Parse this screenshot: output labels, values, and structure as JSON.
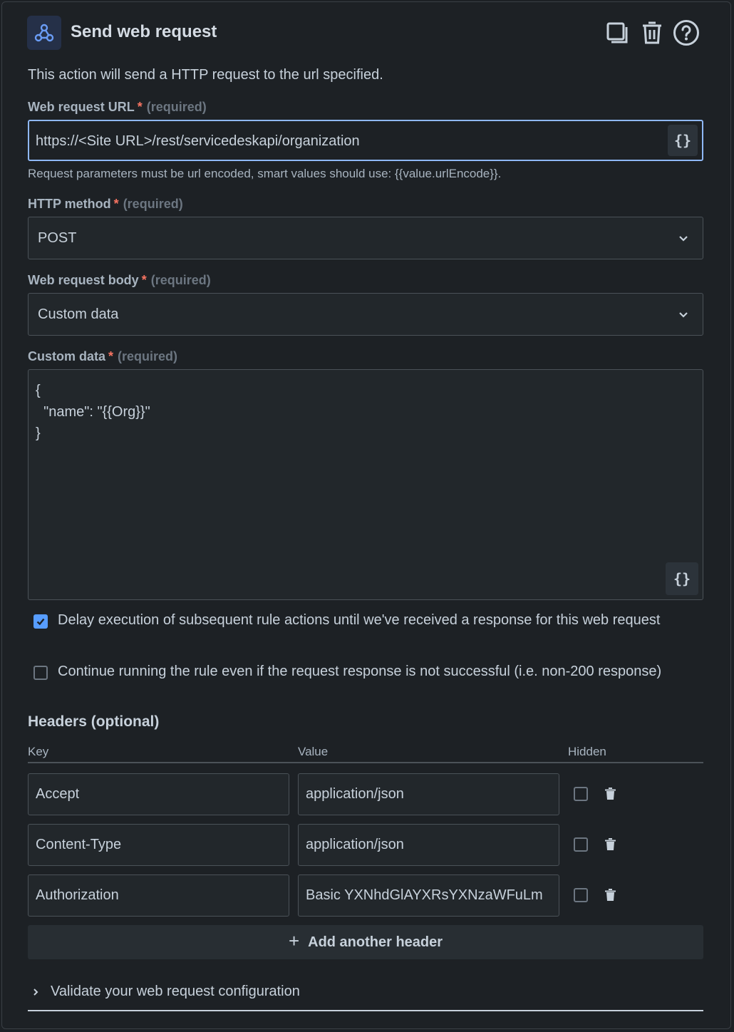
{
  "header": {
    "title": "Send web request",
    "icons": [
      "webhook-icon",
      "copy-icon",
      "trash-icon",
      "help-icon"
    ]
  },
  "description": "This action will send a HTTP request to the url specified.",
  "url": {
    "label": "Web request URL",
    "required_text": "(required)",
    "value": "https://<Site URL>/rest/servicedeskapi/organization",
    "helper": "Request parameters must be url encoded, smart values should use: {{value.urlEncode}}."
  },
  "method": {
    "label": "HTTP method",
    "required_text": "(required)",
    "value": "POST"
  },
  "body": {
    "label": "Web request body",
    "required_text": "(required)",
    "value": "Custom data"
  },
  "custom_data": {
    "label": "Custom data",
    "required_text": "(required)",
    "value": "{\n  \"name\": \"{{Org}}\"\n}"
  },
  "braces_label": "{}",
  "options": {
    "delay_label": "Delay execution of subsequent rule actions until we've received a response for this web request",
    "delay_checked": true,
    "continue_label": "Continue running the rule even if the request response is not successful (i.e. non-200 response)",
    "continue_checked": false
  },
  "headers": {
    "title": "Headers (optional)",
    "col_key": "Key",
    "col_value": "Value",
    "col_hidden": "Hidden",
    "rows": [
      {
        "key": "Accept",
        "value": "application/json",
        "hidden": false
      },
      {
        "key": "Content-Type",
        "value": "application/json",
        "hidden": false
      },
      {
        "key": "Authorization",
        "value": "Basic YXNhdGlAYXRsYXNzaWFuLm",
        "hidden": false
      }
    ],
    "add_label": "Add another header"
  },
  "validate_label": "Validate your web request configuration",
  "colors": {
    "accent": "#579dff",
    "focus_border": "#8fb8f6",
    "required_star": "#f87462"
  }
}
